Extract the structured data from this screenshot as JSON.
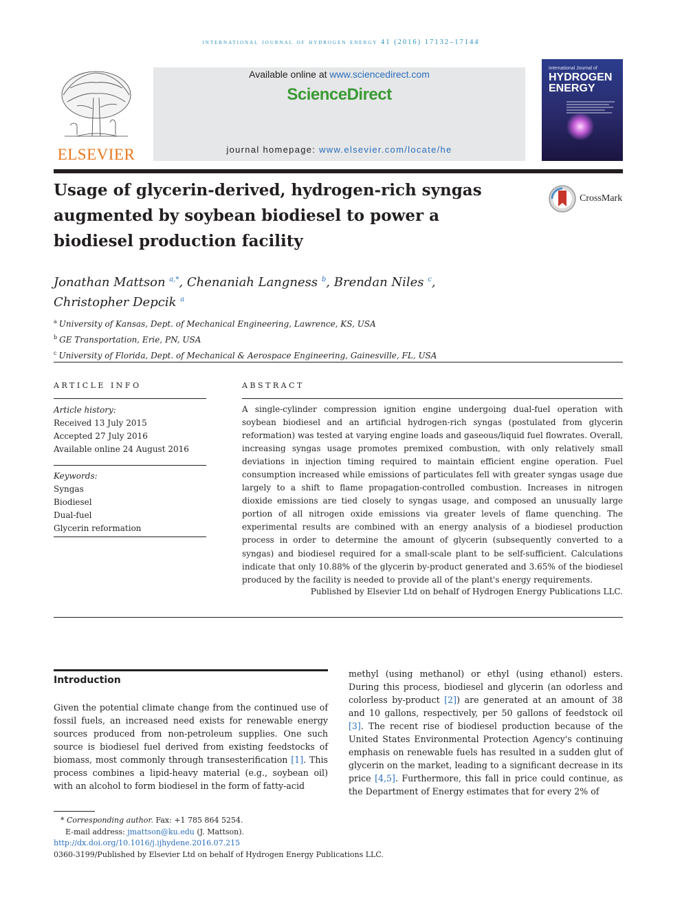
{
  "header": {
    "journal_citation": "international journal of hydrogen energy 41 (2016) 17132–17144",
    "publisher_logo_text": "ELSEVIER",
    "available_online_prefix": "Available online at ",
    "available_online_link": "www.sciencedirect.com",
    "brand": "ScienceDirect",
    "homepage_prefix": "journal homepage: ",
    "homepage_link": "www.elsevier.com/locate/he",
    "cover": {
      "line1": "international Journal of",
      "line2": "HYDROGEN",
      "line3": "ENERGY"
    },
    "crossmark_label": "CrossMark"
  },
  "article": {
    "title_lines": [
      "Usage of glycerin-derived, hydrogen-rich syngas",
      "augmented by soybean biodiesel to power a",
      "biodiesel production facility"
    ],
    "authors": [
      {
        "name": "Jonathan Mattson",
        "sup": "a,*",
        "sep": ", "
      },
      {
        "name": "Chenaniah Langness",
        "sup": "b",
        "sep": ", "
      },
      {
        "name": "Brendan Niles",
        "sup": "c",
        "sep": ","
      },
      {
        "name": "Christopher Depcik",
        "sup": "a",
        "sep": ""
      }
    ],
    "affiliations": [
      {
        "mark": "a",
        "text": "University of Kansas, Dept. of Mechanical Engineering, Lawrence, KS, USA"
      },
      {
        "mark": "b",
        "text": "GE Transportation, Erie, PN, USA"
      },
      {
        "mark": "c",
        "text": "University of Florida, Dept. of Mechanical & Aerospace Engineering, Gainesville, FL, USA"
      }
    ]
  },
  "article_info": {
    "heading": "ARTICLE INFO",
    "history_label": "Article history:",
    "history": [
      "Received 13 July 2015",
      "Accepted 27 July 2016",
      "Available online 24 August 2016"
    ],
    "keywords_label": "Keywords:",
    "keywords": [
      "Syngas",
      "Biodiesel",
      "Dual-fuel",
      "Glycerin reformation"
    ]
  },
  "abstract": {
    "heading": "ABSTRACT",
    "text": "A single-cylinder compression ignition engine undergoing dual-fuel operation with soybean biodiesel and an artificial hydrogen-rich syngas (postulated from glycerin reformation) was tested at varying engine loads and gaseous/liquid fuel flowrates. Overall, increasing syngas usage promotes premixed combustion, with only relatively small deviations in injection timing required to maintain efficient engine operation. Fuel consumption increased while emissions of particulates fell with greater syngas usage due largely to a shift to flame propagation-controlled combustion. Increases in nitrogen dioxide emissions are tied closely to syngas usage, and composed an unusually large portion of all nitrogen oxide emissions via greater levels of flame quenching. The experimental results are combined with an energy analysis of a biodiesel production process in order to determine the amount of glycerin (subsequently converted to a syngas) and biodiesel required for a small-scale plant to be self-sufficient. Calculations indicate that only 10.88% of the glycerin by-product generated and 3.65% of the biodiesel produced by the facility is needed to provide all of the plant's energy requirements.",
    "publisher_note": "Published by Elsevier Ltd on behalf of Hydrogen Energy Publications LLC."
  },
  "body": {
    "intro_heading": "Introduction",
    "left_parts": [
      "Given the potential climate change from the continued use of fossil fuels, an increased need exists for renewable energy sources produced from non-petroleum supplies. One such source is biodiesel fuel derived from existing feedstocks of biomass, most commonly through transesterification ",
      "[1]",
      ". This process combines a lipid-heavy material (e.g., soybean oil) with an alcohol to form biodiesel in the form of fatty-acid"
    ],
    "right_parts": [
      "methyl (using methanol) or ethyl (using ethanol) esters. During this process, biodiesel and glycerin (an odorless and colorless by-product ",
      "[2]",
      ") are generated at an amount of 38 and 10 gallons, respectively, per 50 gallons of feedstock oil ",
      "[3]",
      ". The recent rise of biodiesel production because of the United States Environmental Protection Agency's continuing emphasis on renewable fuels has resulted in a sudden glut of glycerin on the market, leading to a significant decrease in its price ",
      "[4,5]",
      ". Furthermore, this fall in price could continue, as the Department of Energy estimates that for every 2% of"
    ]
  },
  "footnotes": {
    "corresponding": "* Corresponding author. Fax: +1 785 864 5254.",
    "corresponding_label": "Corresponding author.",
    "fax": " Fax: +1 785 864 5254.",
    "email_label": "E-mail address: ",
    "email": "jmattson@ku.edu",
    "email_suffix": " (J. Mattson).",
    "doi": "http://dx.doi.org/10.1016/j.ijhydene.2016.07.215",
    "issn": "0360-3199/Published by Elsevier Ltd on behalf of Hydrogen Energy Publications LLC."
  }
}
